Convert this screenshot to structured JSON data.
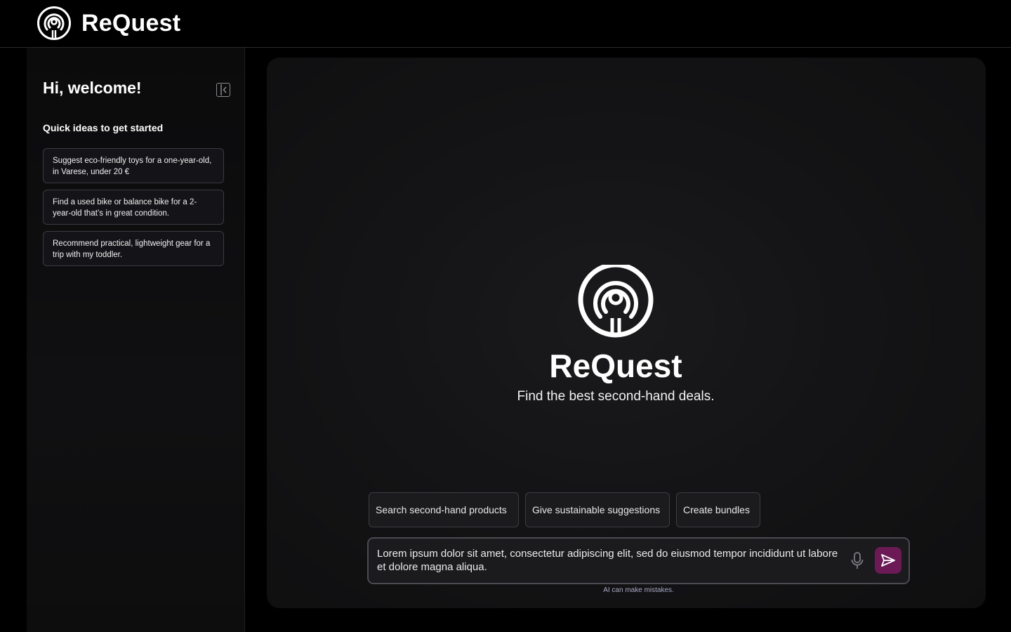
{
  "header": {
    "brand_name": "ReQuest",
    "logo_icon": "concentric-target-logo-icon"
  },
  "sidebar": {
    "greeting": "Hi, welcome!",
    "collapse_icon": "collapse-sidebar-icon",
    "quick_ideas_title": "Quick ideas to get started",
    "ideas": [
      {
        "label": "Suggest eco-friendly toys for a one-year-old, in Varese, under 20 €"
      },
      {
        "label": "Find a used bike or balance bike for a 2-year-old that’s in great condition."
      },
      {
        "label": "Recommend practical, lightweight gear for a trip with my toddler."
      }
    ]
  },
  "main": {
    "hero_title": "ReQuest",
    "hero_subtitle": "Find the best second-hand deals.",
    "chips": [
      {
        "label": "Search second-hand products"
      },
      {
        "label": "Give sustainable suggestions"
      },
      {
        "label": "Create bundles"
      }
    ],
    "prompt": {
      "value": "Lorem ipsum dolor sit amet, consectetur adipiscing elit, sed do eiusmod tempor incididunt ut labore et dolore magna aliqua.",
      "mic_icon": "microphone-icon",
      "send_icon": "send-arrow-icon"
    },
    "disclaimer": "AI can make mistakes."
  },
  "colors": {
    "background": "#000000",
    "panel": "#141416",
    "accent_send": "#6c1a56",
    "disclaimer_text": "#a9a9c8"
  }
}
